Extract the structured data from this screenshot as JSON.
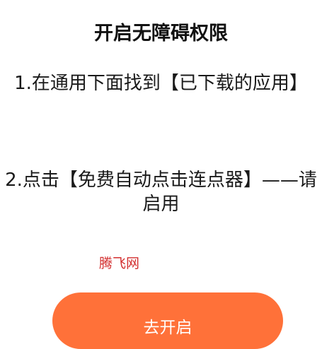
{
  "dialog": {
    "title": "开启无障碍权限",
    "step_1": "1.在通用下面找到【已下载的应用】",
    "step_2": "2.点击【免费自动点击连点器】——请启用",
    "watermark": "腾飞网",
    "open_button_label": "去开启"
  },
  "colors": {
    "accent": "#ff7139",
    "watermark": "#d32f2f",
    "background": "#ffffff",
    "text": "#1a1a1a"
  }
}
